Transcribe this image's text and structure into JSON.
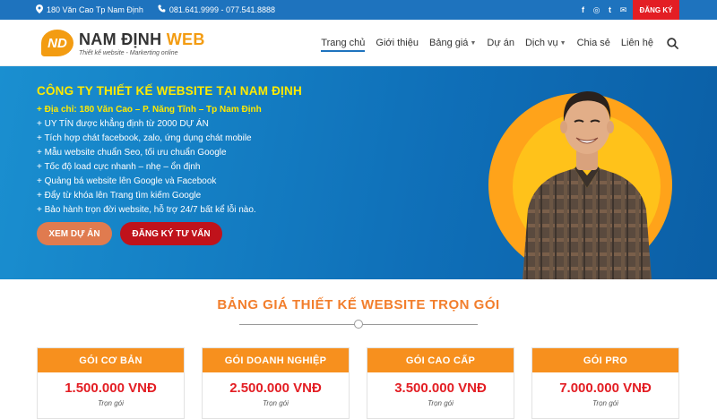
{
  "topbar": {
    "address": "180 Văn Cao Tp Nam Định",
    "phone": "081.641.9999 - 077.541.8888",
    "social": [
      "f",
      "◎",
      "t",
      "✉"
    ],
    "register_label": "ĐĂNG KÝ"
  },
  "header": {
    "logo_mark": "ND",
    "logo_title_main": "NAM ĐỊNH",
    "logo_title_accent": "WEB",
    "logo_tagline": "Thiết kế website - Markerting online"
  },
  "nav": {
    "items": [
      {
        "label": "Trang chủ"
      },
      {
        "label": "Giới thiệu"
      },
      {
        "label": "Bảng giá"
      },
      {
        "label": "Dự án"
      },
      {
        "label": "Dịch vụ"
      },
      {
        "label": "Chia sẻ"
      },
      {
        "label": "Liên hệ"
      }
    ]
  },
  "hero": {
    "title": "CÔNG TY THIẾT KẾ WEBSITE TẠI NAM ĐỊNH",
    "points": [
      "+ Địa chỉ: 180 Văn Cao – P. Năng Tĩnh – Tp Nam Định",
      "+ UY TÍN được khẳng định từ 2000 DỰ ÁN",
      "+ Tích hợp chát facebook, zalo, ứng dụng chát mobile",
      "+ Mẫu website chuẩn Seo, tối ưu chuẩn Google",
      "+ Tốc độ load cực nhanh – nhẹ – ổn định",
      "+ Quảng bá website lên Google và Facebook",
      "+ Đẩy từ khóa lên Trang tìm kiếm Google",
      "+ Bảo hành trọn đời website, hỗ trợ 24/7 bất kể lỗi nào."
    ],
    "btn_project": "XEM DỰ ÁN",
    "btn_consult": "ĐĂNG KÝ TƯ VẤN"
  },
  "pricing": {
    "title": "BẢNG GIÁ THIẾT KẾ WEBSITE TRỌN GÓI",
    "plans": [
      {
        "name": "GÓI CƠ BẢN",
        "price": "1.500.000 VNĐ",
        "note": "Trọn gói"
      },
      {
        "name": "GÓI DOANH NGHIỆP",
        "price": "2.500.000 VNĐ",
        "note": "Trọn gói"
      },
      {
        "name": "GÓI CAO CẤP",
        "price": "3.500.000 VNĐ",
        "note": "Trọn gói"
      },
      {
        "name": "GÓI PRO",
        "price": "7.000.000 VNĐ",
        "note": "Trọn gói"
      }
    ]
  },
  "colors": {
    "brand_blue": "#1e73be",
    "accent_orange": "#f7901e",
    "price_red": "#e31e24",
    "highlight_yellow": "#ffea00"
  }
}
